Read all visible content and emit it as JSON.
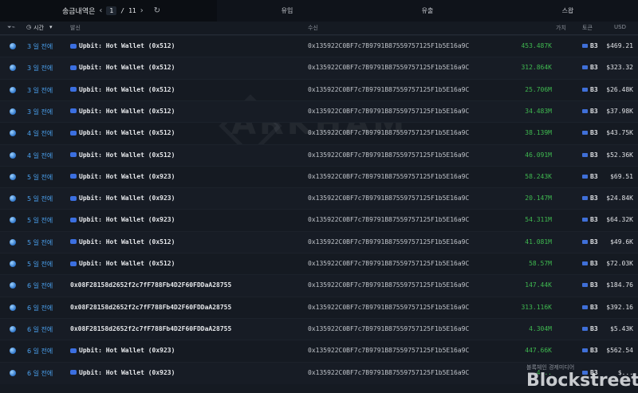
{
  "pager": {
    "title": "송금내역은",
    "current": "1",
    "separator": "/",
    "total": "11",
    "prev": "‹",
    "next": "›",
    "refresh": "↻"
  },
  "tabs": [
    "유입",
    "유출",
    "스왑"
  ],
  "header": {
    "time": "시간",
    "from": "발신",
    "to": "수신",
    "value": "가치",
    "token": "토큰",
    "usd": "USD"
  },
  "rows": [
    {
      "time": "3 일 전에",
      "from": "Upbit: Hot Wallet (0x512)",
      "to": "0x135922C0BF7c7B9791B87559757125F1b5E16a9C",
      "value": "453.487K",
      "token": "B3",
      "usd": "$469.21"
    },
    {
      "time": "3 일 전에",
      "from": "Upbit: Hot Wallet (0x512)",
      "to": "0x135922C0BF7c7B9791B87559757125F1b5E16a9C",
      "value": "312.864K",
      "token": "B3",
      "usd": "$323.32"
    },
    {
      "time": "3 일 전에",
      "from": "Upbit: Hot Wallet (0x512)",
      "to": "0x135922C0BF7c7B9791B87559757125F1b5E16a9C",
      "value": "25.706M",
      "token": "B3",
      "usd": "$26.48K"
    },
    {
      "time": "3 일 전에",
      "from": "Upbit: Hot Wallet (0x512)",
      "to": "0x135922C0BF7c7B9791B87559757125F1b5E16a9C",
      "value": "34.483M",
      "token": "B3",
      "usd": "$37.98K"
    },
    {
      "time": "4 일 전에",
      "from": "Upbit: Hot Wallet (0x512)",
      "to": "0x135922C0BF7c7B9791B87559757125F1b5E16a9C",
      "value": "38.139M",
      "token": "B3",
      "usd": "$43.75K"
    },
    {
      "time": "4 일 전에",
      "from": "Upbit: Hot Wallet (0x512)",
      "to": "0x135922C0BF7c7B9791B87559757125F1b5E16a9C",
      "value": "46.091M",
      "token": "B3",
      "usd": "$52.36K"
    },
    {
      "time": "5 일 전에",
      "from": "Upbit: Hot Wallet (0x923)",
      "to": "0x135922C0BF7c7B9791B87559757125F1b5E16a9C",
      "value": "58.243K",
      "token": "B3",
      "usd": "$69.51"
    },
    {
      "time": "5 일 전에",
      "from": "Upbit: Hot Wallet (0x923)",
      "to": "0x135922C0BF7c7B9791B87559757125F1b5E16a9C",
      "value": "20.147M",
      "token": "B3",
      "usd": "$24.84K"
    },
    {
      "time": "5 일 전에",
      "from": "Upbit: Hot Wallet (0x923)",
      "to": "0x135922C0BF7c7B9791B87559757125F1b5E16a9C",
      "value": "54.311M",
      "token": "B3",
      "usd": "$64.32K"
    },
    {
      "time": "5 일 전에",
      "from": "Upbit: Hot Wallet (0x512)",
      "to": "0x135922C0BF7c7B9791B87559757125F1b5E16a9C",
      "value": "41.081M",
      "token": "B3",
      "usd": "$49.6K"
    },
    {
      "time": "5 일 전에",
      "from": "Upbit: Hot Wallet (0x512)",
      "to": "0x135922C0BF7c7B9791B87559757125F1b5E16a9C",
      "value": "58.57M",
      "token": "B3",
      "usd": "$72.03K"
    },
    {
      "time": "6 일 전에",
      "from": "0x08F28158d2652f2c7fF788Fb4D2F60FDDaA28755",
      "to": "0x135922C0BF7c7B9791B87559757125F1b5E16a9C",
      "value": "147.44K",
      "token": "B3",
      "usd": "$184.76"
    },
    {
      "time": "6 일 전에",
      "from": "0x08F28158d2652f2c7fF788Fb4D2F60FDDaA28755",
      "to": "0x135922C0BF7c7B9791B87559757125F1b5E16a9C",
      "value": "313.116K",
      "token": "B3",
      "usd": "$392.16"
    },
    {
      "time": "6 일 전에",
      "from": "0x08F28158d2652f2c7fF788Fb4D2F60FDDaA28755",
      "to": "0x135922C0BF7c7B9791B87559757125F1b5E16a9C",
      "value": "4.304M",
      "token": "B3",
      "usd": "$5.43K"
    },
    {
      "time": "6 일 전에",
      "from": "Upbit: Hot Wallet (0x923)",
      "to": "0x135922C0BF7c7B9791B87559757125F1b5E16a9C",
      "value": "447.66K",
      "token": "B3",
      "usd": "$562.54"
    },
    {
      "time": "6 일 전에",
      "from": "Upbit: Hot Wallet (0x923)",
      "to": "0x135922C0BF7c7B9791B87559757125F1b5E16a9C",
      "value": "4...",
      "token": "B3",
      "usd": "$..."
    }
  ],
  "watermark": "ARKHAM",
  "footer": {
    "label": "블록체인 경제미디어",
    "brand": "Blockstreet"
  },
  "colors": {
    "accent": "#4aa0ee",
    "positive": "#3fb950",
    "background": "#151a22"
  }
}
